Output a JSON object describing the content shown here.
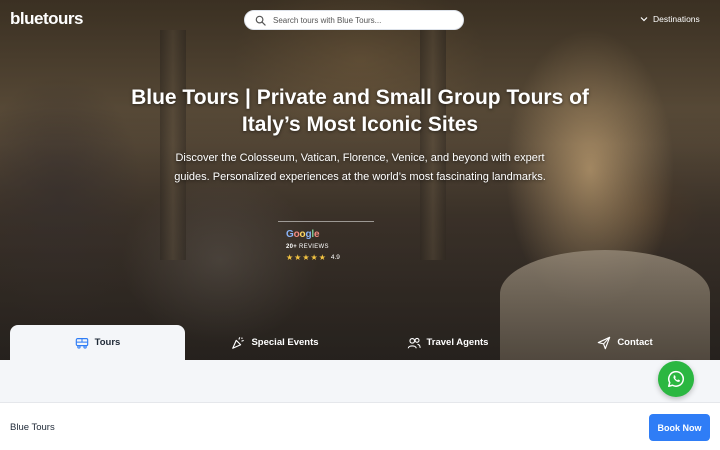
{
  "header": {
    "logo": "bluetours",
    "search_placeholder": "Search tours with Blue Tours...",
    "destinations_label": "Destinations"
  },
  "hero": {
    "title": "Blue Tours | Private and Small Group Tours of Italy’s Most Iconic Sites",
    "subtitle": "Discover the Colosseum, Vatican, Florence, Venice, and beyond with expert guides. Personalized experiences at the world’s most fascinating landmarks."
  },
  "google_badge": {
    "brand": "Google",
    "reviews_count": "20+",
    "reviews_label": "REVIEWS",
    "stars": 5,
    "rating": "4.9"
  },
  "tabs": [
    {
      "label": "Tours",
      "icon": "bus-icon",
      "active": true
    },
    {
      "label": "Special Events",
      "icon": "party-popper-icon",
      "active": false
    },
    {
      "label": "Travel Agents",
      "icon": "users-icon",
      "active": false
    },
    {
      "label": "Contact",
      "icon": "paper-plane-icon",
      "active": false
    }
  ],
  "footer": {
    "title": "Blue Tours",
    "book_label": "Book Now"
  },
  "colors": {
    "accent": "#2f7df6",
    "whatsapp": "#2bb741",
    "star": "#f5c542"
  }
}
